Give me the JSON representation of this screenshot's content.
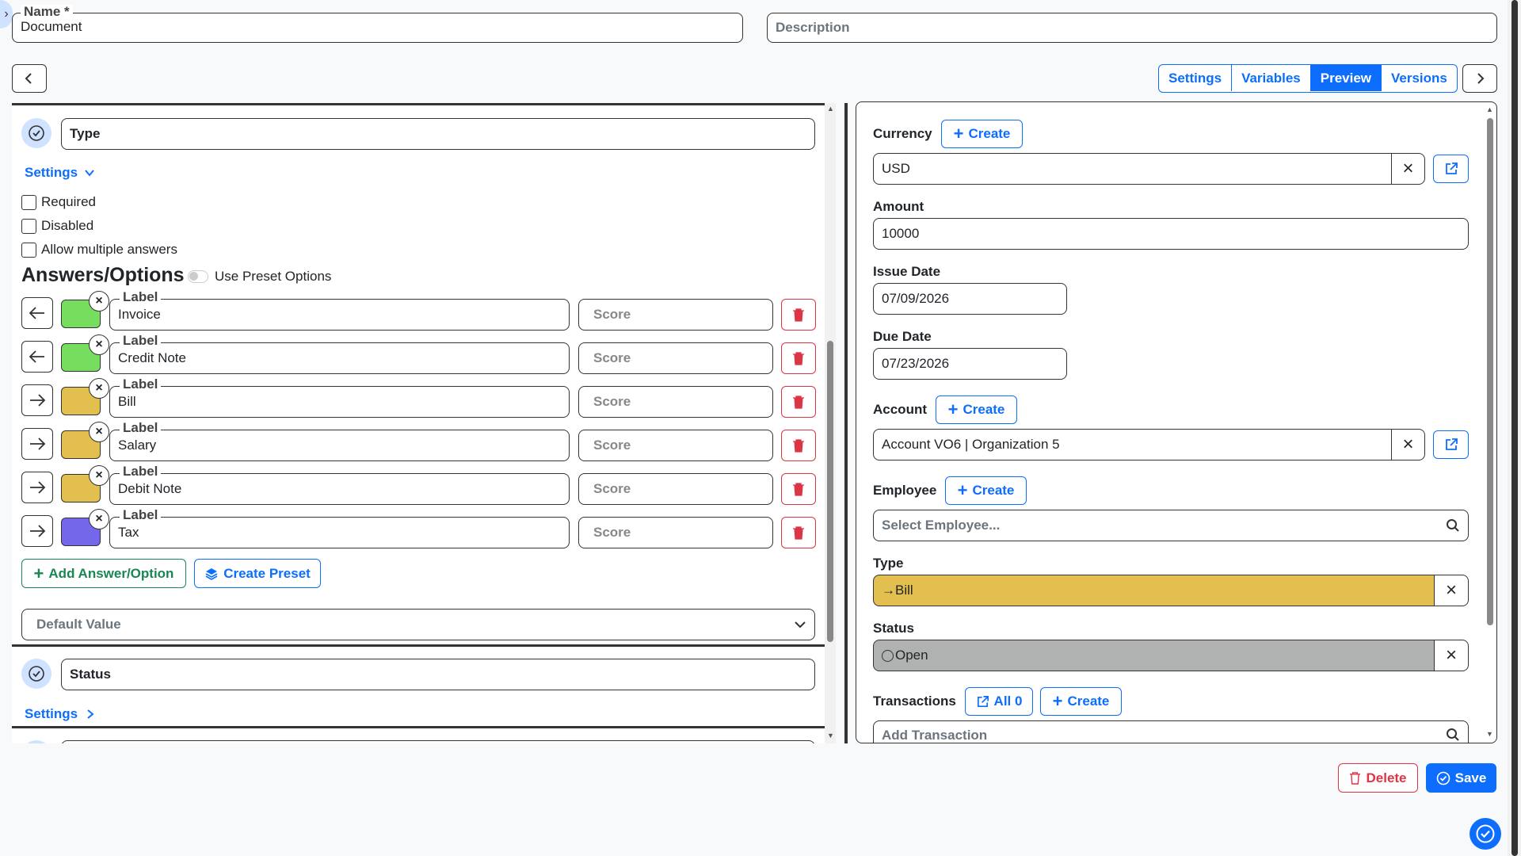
{
  "top": {
    "name_legend": "Name *",
    "name_value": "Document",
    "description_placeholder": "Description"
  },
  "tabs": [
    "Settings",
    "Variables",
    "Preview",
    "Versions"
  ],
  "active_tab": "Preview",
  "left": {
    "type_field_value": "Type",
    "settings_label": "Settings",
    "checkboxes": [
      "Required",
      "Disabled",
      "Allow multiple answers"
    ],
    "answers_heading": "Answers/Options",
    "use_preset_label": "Use Preset Options",
    "options": [
      {
        "label_legend": "Label",
        "value": "Invoice",
        "score_placeholder": "Score",
        "direction": "left",
        "color": "#77dd5f"
      },
      {
        "label_legend": "Label",
        "value": "Credit Note",
        "score_placeholder": "Score",
        "direction": "left",
        "color": "#77dd5f"
      },
      {
        "label_legend": "Label",
        "value": "Bill",
        "score_placeholder": "Score",
        "direction": "right",
        "color": "#e2bf4f"
      },
      {
        "label_legend": "Label",
        "value": "Salary",
        "score_placeholder": "Score",
        "direction": "right",
        "color": "#e2bf4f"
      },
      {
        "label_legend": "Label",
        "value": "Debit Note",
        "score_placeholder": "Score",
        "direction": "right",
        "color": "#e2bf4f"
      },
      {
        "label_legend": "Label",
        "value": "Tax",
        "score_placeholder": "Score",
        "direction": "right",
        "color": "#7567ea"
      }
    ],
    "add_option_label": "Add Answer/Option",
    "create_preset_label": "Create Preset",
    "default_value_placeholder": "Default Value",
    "status_field_value": "Status",
    "status_settings_label": "Settings"
  },
  "right": {
    "currency_label": "Currency",
    "create_label": "Create",
    "currency_value": "USD",
    "amount_label": "Amount",
    "amount_value": "10000",
    "issue_date_label": "Issue Date",
    "issue_date_value": "07/09/2026",
    "due_date_label": "Due Date",
    "due_date_value": "07/23/2026",
    "account_label": "Account",
    "account_value": "Account VO6 | Organization 5",
    "employee_label": "Employee",
    "employee_placeholder": "Select Employee...",
    "type_label": "Type",
    "type_value": "Bill",
    "type_color": "#e2bf4f",
    "status_label": "Status",
    "status_value": "Open",
    "status_color": "#b0b2b1",
    "transactions_label": "Transactions",
    "all_label": "All 0",
    "add_transaction_placeholder": "Add Transaction"
  },
  "footer": {
    "delete_label": "Delete",
    "save_label": "Save"
  },
  "colors": {
    "primary": "#0d6efd",
    "danger": "#dc3545",
    "success": "#198754"
  }
}
